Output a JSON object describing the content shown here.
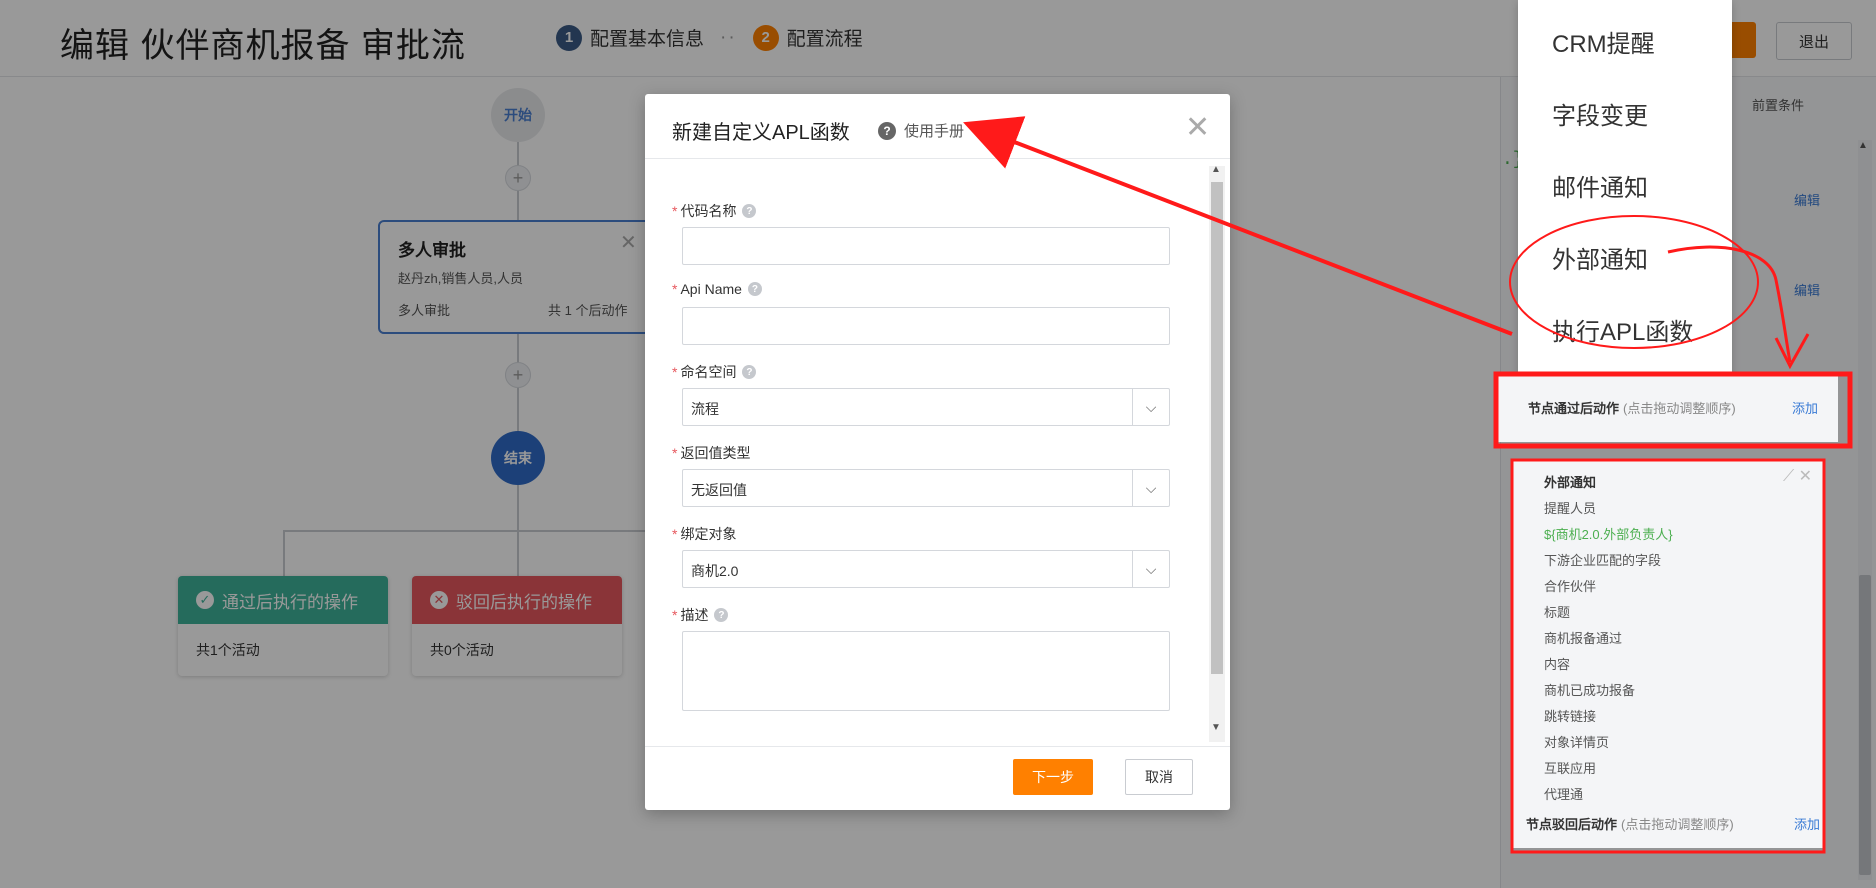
{
  "header": {
    "title": "编辑 伙伴商机报备 审批流",
    "steps": [
      {
        "num": "1",
        "label": "配置基本信息"
      },
      {
        "num": "2",
        "label": "配置流程"
      }
    ],
    "step_separator": "··",
    "exit_label": "退出"
  },
  "flow": {
    "start_label": "开始",
    "plus_label": "+",
    "approval": {
      "title": "多人审批",
      "assignees": "赵丹zh,销售人员,人员",
      "type": "多人审批",
      "action_count": "共 1 个后动作",
      "close": "✕"
    },
    "end_label": "结束",
    "pass_card": {
      "title": "通过后执行的操作",
      "count": "共1个活动",
      "icon": "✓"
    },
    "reject_card": {
      "title": "驳回后执行的操作",
      "count": "共0个活动",
      "icon": "✕"
    }
  },
  "right_panel": {
    "pre_condition": "前置条件",
    "code_brace": ".}",
    "edit_label": "编辑",
    "menu_items": [
      "CRM提醒",
      "字段变更",
      "邮件通知",
      "外部通知",
      "执行APL函数"
    ],
    "after_pass_title": "节点通过后动作",
    "after_pass_hint": "(点击拖动调整顺序)",
    "add_label": "添加",
    "action_detail": {
      "heading": "外部通知",
      "rows": [
        "提醒人员",
        "${商机2.0.外部负责人}",
        "下游企业匹配的字段",
        "合作伙伴",
        "标题",
        "商机报备通过",
        "内容",
        "商机已成功报备",
        "跳转链接",
        "对象详情页",
        "互联应用",
        "代理通"
      ],
      "tools": "⟋ ✕"
    },
    "after_reject_title": "节点驳回后动作",
    "after_reject_hint": "(点击拖动调整顺序)"
  },
  "modal": {
    "title": "新建自定义APL函数",
    "help_label": "使用手册",
    "help_icon": "?",
    "close": "✕",
    "required_mark": "*",
    "tip_icon": "?",
    "fields": {
      "code_name": {
        "label": "代码名称",
        "value": ""
      },
      "api_name": {
        "label": "Api Name",
        "value": ""
      },
      "namespace": {
        "label": "命名空间",
        "value": "流程"
      },
      "return_type": {
        "label": "返回值类型",
        "value": "无返回值"
      },
      "bind_object": {
        "label": "绑定对象",
        "value": "商机2.0"
      },
      "description": {
        "label": "描述",
        "value": ""
      }
    },
    "dropdown_arrow": "⌵",
    "next_label": "下一步",
    "cancel_label": "取消"
  },
  "colors": {
    "accent_orange": "#ff8000",
    "primary_blue": "#2f6cc9",
    "pass_green": "#3fb39a",
    "reject_red": "#e7585e",
    "annotation_red": "#ff1a1a"
  }
}
